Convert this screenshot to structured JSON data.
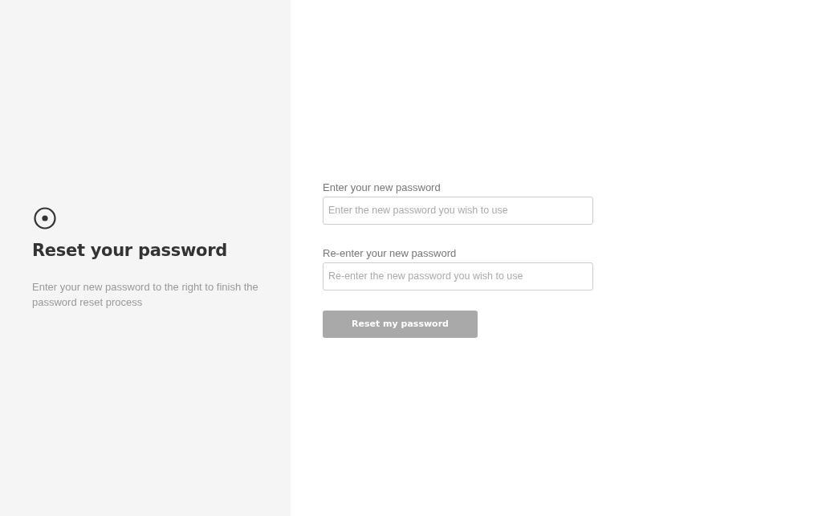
{
  "intro": {
    "title": "Reset your password",
    "description": "Enter your new password to the right to finish the password reset process"
  },
  "fields": [
    {
      "label": "Enter your new password",
      "placeholder": "Enter the new password you wish to use"
    },
    {
      "label": "Re-enter your new password",
      "placeholder": "Re-enter the new password you wish to use"
    }
  ],
  "submit": {
    "label": "Reset my password",
    "disabled": true
  }
}
